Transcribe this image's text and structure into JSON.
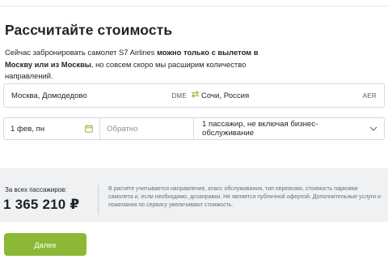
{
  "page": {
    "title": "Рассчитайте стоимость",
    "description": {
      "part1": "Сейчас забронировать самолет S7 Airlines ",
      "bold1": "можно только с вылетом в Москву или из Москвы",
      "part2": ", но совсем скоро мы расширим количество направлений."
    }
  },
  "route": {
    "from": {
      "city": "Москва, Домодедово",
      "code": "DME"
    },
    "to": {
      "city": "Сочи, Россия",
      "code": "AER"
    }
  },
  "dates": {
    "departure": "1 фев, пн",
    "return_placeholder": "Обратно"
  },
  "passengers": {
    "selected": "1 пассажир, не включая бизнес-обслуживание"
  },
  "summary": {
    "label": "За всех пассажиров:",
    "total": "1 365 210 ₽",
    "note": "В расчете учитывается направление, класс обслуживания, тип перевозки, стоимость парковки самолета и, если необходимо, дозаправки. Не является публичной офертой. Дополнительные услуги и пожелания по сервису увеличивают стоимость."
  },
  "actions": {
    "next_label": "Далее"
  },
  "colors": {
    "accent": "#8cb836",
    "summary_bg": "#eff1f3",
    "border": "#d5d9dc"
  },
  "icons": {
    "swap": "swap-arrows-icon",
    "calendar": "calendar-icon",
    "dropdown": "chevron-down-icon"
  }
}
